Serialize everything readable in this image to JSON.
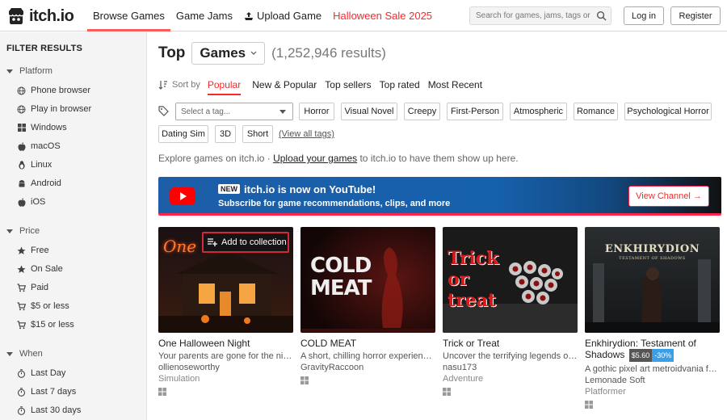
{
  "header": {
    "logo_text": "itch.io",
    "nav": [
      {
        "label": "Browse Games"
      },
      {
        "label": "Game Jams"
      },
      {
        "label": "Upload Game"
      },
      {
        "label": "Halloween Sale 2025"
      }
    ],
    "search_placeholder": "Search for games, jams, tags or creators",
    "login_label": "Log in",
    "register_label": "Register"
  },
  "sidebar": {
    "title": "FILTER RESULTS",
    "platform": {
      "label": "Platform",
      "items": [
        "Phone browser",
        "Play in browser",
        "Windows",
        "macOS",
        "Linux",
        "Android",
        "iOS"
      ]
    },
    "price": {
      "label": "Price",
      "items": [
        "Free",
        "On Sale",
        "Paid",
        "$5 or less",
        "$15 or less"
      ]
    },
    "when": {
      "label": "When",
      "items": [
        "Last Day",
        "Last 7 days",
        "Last 30 days"
      ]
    }
  },
  "main": {
    "title": "Top",
    "category": "Games",
    "count": "(1,252,946 results)",
    "sort_label": "Sort by",
    "sort_options": [
      "Popular",
      "New & Popular",
      "Top sellers",
      "Top rated",
      "Most Recent"
    ],
    "tag_placeholder": "Select a tag...",
    "tags": [
      "Horror",
      "Visual Novel",
      "Creepy",
      "First-Person",
      "Atmospheric",
      "Romance",
      "Psychological Horror",
      "Dating Sim",
      "3D",
      "Short"
    ],
    "view_all": "(View all tags)",
    "explore_prefix": "Explore games on itch.io · ",
    "explore_link": "Upload your games",
    "explore_suffix": " to itch.io to have them show up here."
  },
  "banner": {
    "badge": "NEW",
    "title": "itch.io is now on YouTube!",
    "subtitle": "Subscribe for game recommendations, clips, and more",
    "button": "View Channel →"
  },
  "games": [
    {
      "title": "One Halloween Night",
      "desc": "Your parents are gone for the night...",
      "author": "ollienoseworthy",
      "genre": "Simulation",
      "thumb_text": "One",
      "overlay": "Add to collection"
    },
    {
      "title": "COLD MEAT",
      "desc": "A short, chilling horror experience w...",
      "author": "GravityRaccoon",
      "genre": "",
      "thumb_text": "COLD MEAT"
    },
    {
      "title": "Trick or Treat",
      "desc": "Uncover the terrifying legends of H...",
      "author": "nasu173",
      "genre": "Adventure",
      "thumb_text": "Trick or treat"
    },
    {
      "title": "Enkhirydion: Testament of Shadows",
      "price": "$5.60",
      "discount": "-30%",
      "desc": "A gothic pixel art metroidvania forg...",
      "author": "Lemonade Soft",
      "genre": "Platformer",
      "thumb_text": "ENKHIRYDION",
      "thumb_sub": "TESTAMENT OF SHADOWS"
    }
  ],
  "colors": {
    "accent": "#fa5c5c",
    "sale": "#fa2828",
    "banner_blue": "#1661ac"
  }
}
